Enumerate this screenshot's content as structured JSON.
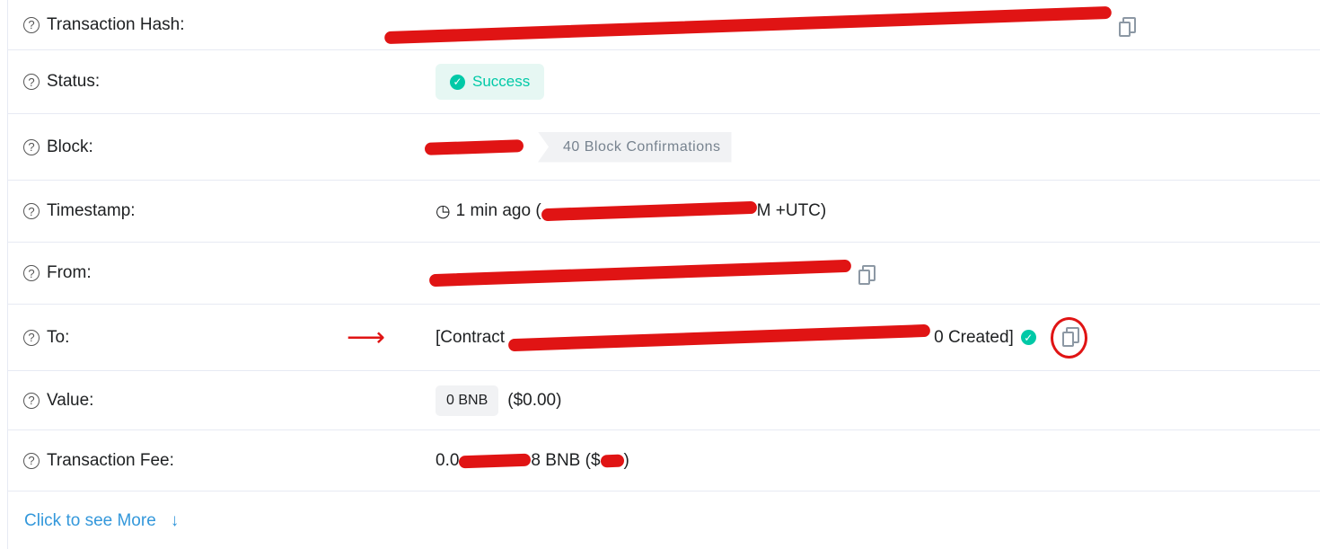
{
  "rows": {
    "hash": {
      "label": "Transaction Hash:"
    },
    "status": {
      "label": "Status:",
      "value": "Success"
    },
    "block": {
      "label": "Block:",
      "confirmations": "40 Block Confirmations"
    },
    "timestamp": {
      "label": "Timestamp:",
      "prefix": "1 min ago (",
      "suffix": "M +UTC)"
    },
    "from": {
      "label": "From:"
    },
    "to": {
      "label": "To:",
      "prefix": "[Contract",
      "suffix": "0 Created]"
    },
    "value": {
      "label": "Value:",
      "amount": "0 BNB",
      "usd": "($0.00)"
    },
    "fee": {
      "label": "Transaction Fee:",
      "prefix": "0.0",
      "middle": "8 BNB ($",
      "suffix": ")"
    }
  },
  "more_link": "Click to see More",
  "colors": {
    "success": "#00c9a7",
    "link": "#3498db",
    "annotation": "#e01414"
  }
}
